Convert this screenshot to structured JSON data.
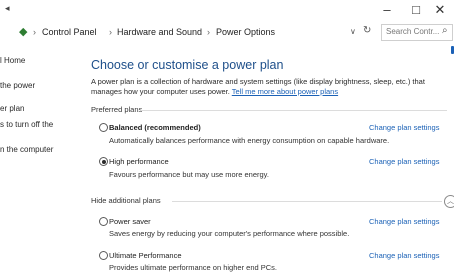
{
  "window": {
    "minimize": "–",
    "maximize": "□",
    "close": "✕"
  },
  "address": {
    "crumbs": [
      "Control Panel",
      "Hardware and Sound",
      "Power Options"
    ],
    "dropdown": "∨",
    "refresh": "↻",
    "search_placeholder": "Search Contr...",
    "search_icon": "⌕"
  },
  "sidebar": {
    "items": [
      "l Home",
      "the power",
      "er plan",
      "s to turn off the",
      "n the computer"
    ]
  },
  "main": {
    "title": "Choose or customise a power plan",
    "intro_line1": "A power plan is a collection of hardware and system settings (like display brightness, sleep, etc.) that",
    "intro_line2_text": "manages how your computer uses power.",
    "intro_link": "Tell me more about power plans",
    "preferred_label": "Preferred plans",
    "hide_label": "Hide additional plans",
    "change_label": "Change plan settings",
    "plans": [
      {
        "name": "Balanced (recommended)",
        "desc": "Automatically balances performance with energy consumption on capable hardware.",
        "selected": false
      },
      {
        "name": "High performance",
        "desc": "Favours performance but may use more energy.",
        "selected": true
      },
      {
        "name": "Power saver",
        "desc": "Saves energy by reducing your computer's performance where possible.",
        "selected": false
      },
      {
        "name": "Ultimate Performance",
        "desc": "Provides ultimate performance on higher end PCs.",
        "selected": false
      }
    ]
  }
}
